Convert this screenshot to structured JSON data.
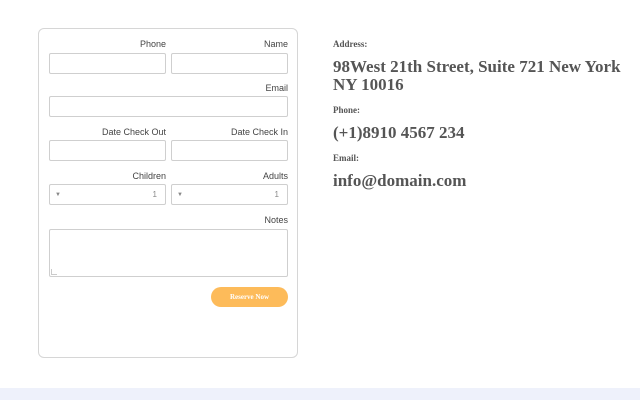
{
  "form": {
    "labels": {
      "phone": "Phone",
      "name": "Name",
      "email": "Email",
      "date_check_out": "Date Check Out",
      "date_check_in": "Date Check In",
      "children": "Children",
      "adults": "Adults",
      "notes": "Notes"
    },
    "inputs": {
      "phone": "",
      "name": "",
      "email": "",
      "date_check_out": "",
      "date_check_in": ""
    },
    "selects": {
      "children": "1",
      "adults": "1"
    },
    "notes_value": "",
    "submit_label": "Reserve Now"
  },
  "contact": {
    "address_label": "Address:",
    "address_value": "98West 21th Street, Suite 721 New York NY 10016",
    "phone_label": "Phone:",
    "phone_value": "(+1)8910 4567 234",
    "email_label": "Email:",
    "email_value": "info@domain.com"
  },
  "colors": {
    "button": "#fdbb5a",
    "bottom_band": "#eef1fb"
  }
}
